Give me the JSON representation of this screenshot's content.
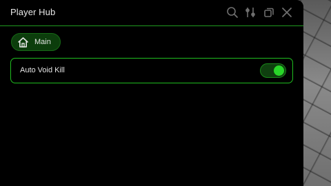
{
  "window": {
    "title": "Player Hub"
  },
  "titlebar_icons": [
    {
      "name": "search-icon"
    },
    {
      "name": "settings-sliders-icon"
    },
    {
      "name": "minimize-restore-icon"
    },
    {
      "name": "close-icon"
    }
  ],
  "tabs": [
    {
      "label": "Main",
      "icon": "home-icon",
      "selected": true
    }
  ],
  "settings": [
    {
      "label": "Auto Void Kill",
      "type": "toggle",
      "enabled": true
    }
  ],
  "colors": {
    "accent": "#29d629",
    "border": "#1fbf1f",
    "tab_bg": "#0c3d0c",
    "window_bg": "#000000"
  }
}
